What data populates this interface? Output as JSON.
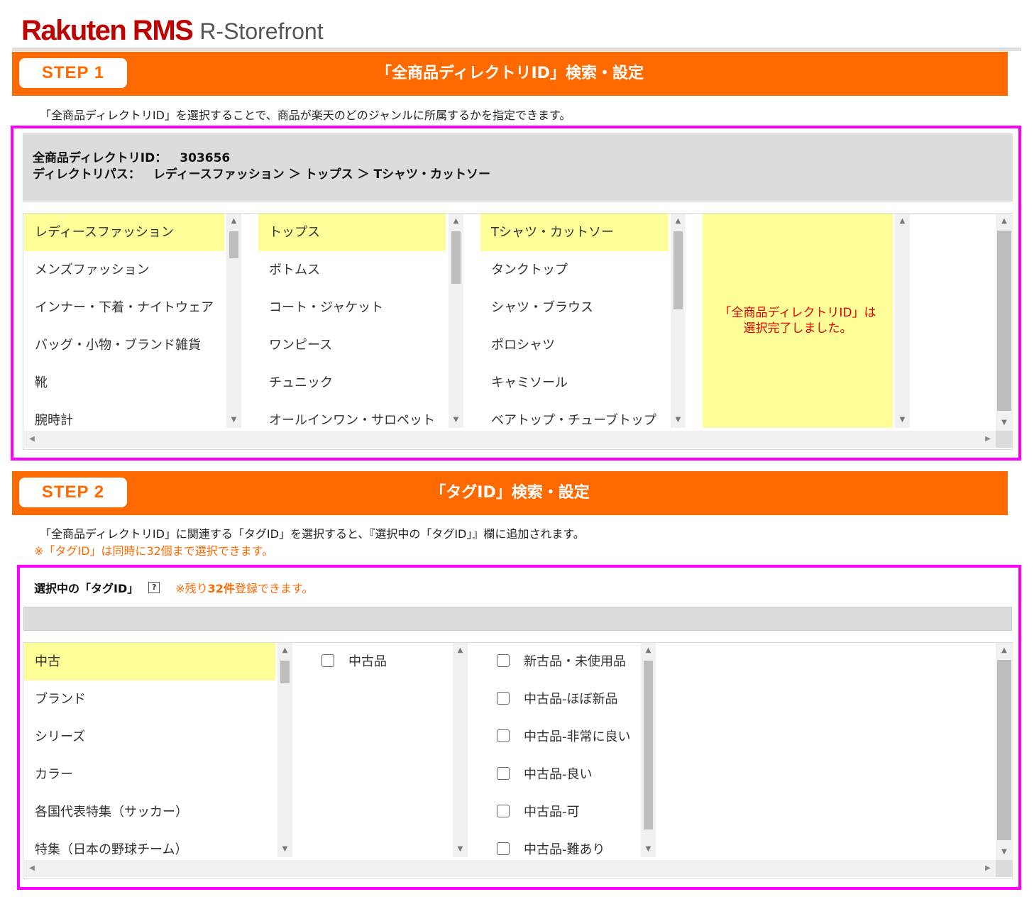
{
  "header": {
    "brand": "Rakuten RMS",
    "product": "R-Storefront"
  },
  "step1": {
    "badge": "STEP 1",
    "title": "「全商品ディレクトリID」検索・設定",
    "description": "「全商品ディレクトリID」を選択することで、商品が楽天のどのジャンルに所属するかを指定できます。",
    "id_label": "全商品ディレクトリID：",
    "id_value": "303656",
    "path_label": "ディレクトリパス：",
    "path_value": "レディースファッション ＞ トップス ＞ Tシャツ・カットソー",
    "columns": [
      {
        "items": [
          "レディースファッション",
          "メンズファッション",
          "インナー・下着・ナイトウェア",
          "バッグ・小物・ブランド雑貨",
          "靴",
          "腕時計"
        ],
        "selected": 0
      },
      {
        "items": [
          "トップス",
          "ボトムス",
          "コート・ジャケット",
          "ワンピース",
          "チュニック",
          "オールインワン・サロペット"
        ],
        "selected": 0
      },
      {
        "items": [
          "Tシャツ・カットソー",
          "タンクトップ",
          "シャツ・ブラウス",
          "ポロシャツ",
          "キャミソール",
          "ベアトップ・チューブトップ"
        ],
        "selected": 0
      }
    ],
    "complete_message_line1": "「全商品ディレクトリID」は",
    "complete_message_line2": "選択完了しました。"
  },
  "step2": {
    "badge": "STEP 2",
    "title": "「タグID」検索・設定",
    "description": "「全商品ディレクトリID」に関連する「タグID」を選択すると、『選択中の「タグID」』欄に追加されます。",
    "note": "※「タグID」は同時に32個まで選択できます。",
    "selected_label": "選択中の「タグID」",
    "help_icon": "?",
    "remaining_prefix": "※残り",
    "remaining_count": "32件",
    "remaining_suffix": "登録できます。",
    "columns": [
      {
        "items": [
          "中古",
          "ブランド",
          "シリーズ",
          "カラー",
          "各国代表特集（サッカー）",
          "特集（日本の野球チーム）"
        ],
        "selected": 0
      },
      {
        "items": [
          "中古品"
        ]
      },
      {
        "items": [
          "新古品・未使用品",
          "中古品-ほぼ新品",
          "中古品-非常に良い",
          "中古品-良い",
          "中古品-可",
          "中古品-難あり"
        ]
      }
    ]
  },
  "colors": {
    "accent": "#ff6a00",
    "brand": "#bf0000",
    "highlight": "#fefe98",
    "frame": "#ff00ff",
    "error": "#e60000"
  }
}
